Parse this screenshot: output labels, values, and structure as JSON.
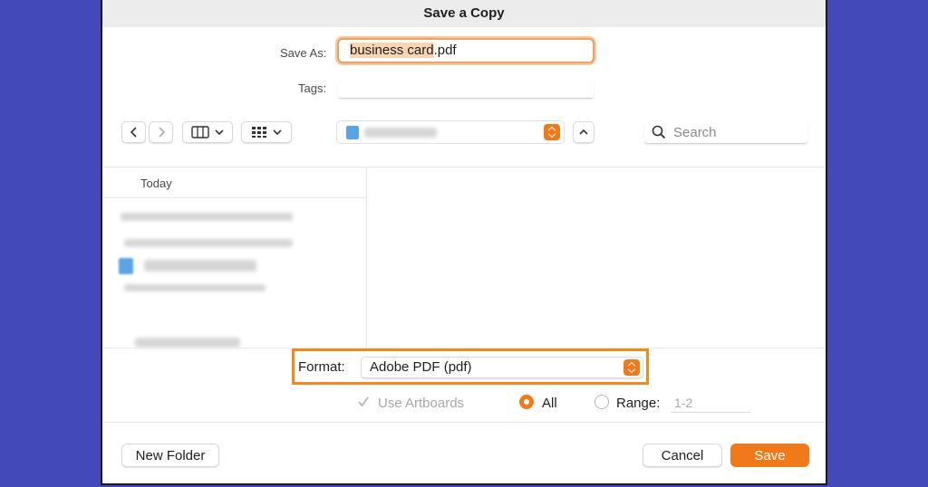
{
  "dialog": {
    "title": "Save a Copy"
  },
  "save_as": {
    "label": "Save As:",
    "value": "business card.pdf",
    "selected_part": "business card",
    "extension": ".pdf"
  },
  "tags": {
    "label": "Tags:",
    "value": ""
  },
  "toolbar": {
    "back_icon": "chevron-left-icon",
    "forward_icon": "chevron-right-icon",
    "view_columns_icon": "columns-icon",
    "view_grid_icon": "grid-icon",
    "collapse_icon": "chevron-up-icon"
  },
  "search": {
    "placeholder": "Search"
  },
  "sidebar": {
    "section_header": "Today"
  },
  "format": {
    "label": "Format:",
    "value": "Adobe PDF (pdf)"
  },
  "options": {
    "use_artboards_label": "Use Artboards",
    "use_artboards_checked": true,
    "all_label": "All",
    "all_selected": true,
    "range_label": "Range:",
    "range_value": "1-2"
  },
  "buttons": {
    "new_folder": "New Folder",
    "cancel": "Cancel",
    "save": "Save"
  },
  "colors": {
    "background": "#4349b8",
    "accent": "#f07a1a",
    "highlight_border": "#f08a1a"
  }
}
